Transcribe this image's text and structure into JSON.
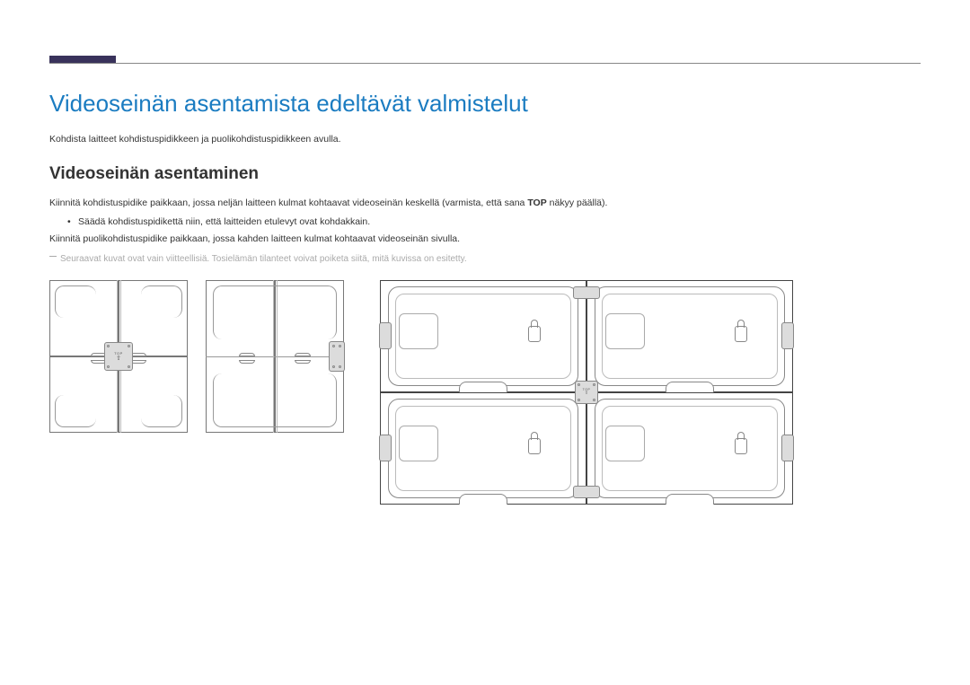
{
  "heading1": "Videoseinän asentamista edeltävät valmistelut",
  "lead": "Kohdista laitteet kohdistuspidikkeen ja puolikohdistuspidikkeen avulla.",
  "heading2": "Videoseinän asentaminen",
  "para1_a": "Kiinnitä kohdistuspidike paikkaan, jossa neljän laitteen kulmat kohtaavat videoseinän keskellä (varmista, että sana ",
  "para1_bold": "TOP",
  "para1_b": " näkyy päällä).",
  "bullet1": "Säädä kohdistuspidikettä niin, että laitteiden etulevyt ovat kohdakkain.",
  "para2": "Kiinnitä puolikohdistuspidike paikkaan, jossa kahden laitteen kulmat kohtaavat videoseinän sivulla.",
  "note": "Seuraavat kuvat ovat vain viitteellisiä. Tosielämän tilanteet voivat poiketa siitä, mitä kuvissa on esitetty.",
  "bracket_top_label": "TOP",
  "bracket_arrow": "⇧"
}
